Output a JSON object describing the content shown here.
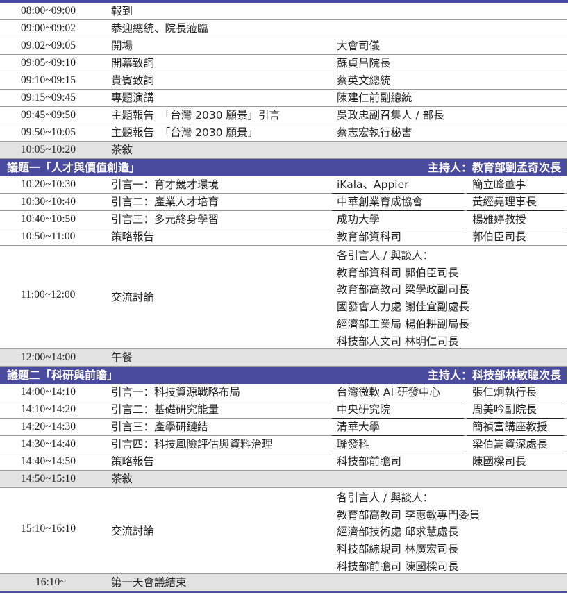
{
  "colors": {
    "accent": "#4a4a9e",
    "gray_row": "#e3e3e3"
  },
  "block1": [
    {
      "time": "08:00~09:00",
      "item": "報到",
      "who": "",
      "role": ""
    },
    {
      "time": "09:00~09:02",
      "item": "恭迎總統、院長蒞臨",
      "who": "",
      "role": ""
    },
    {
      "time": "09:02~09:05",
      "item": "開場",
      "who": "大會司儀",
      "role": ""
    },
    {
      "time": "09:05~09:10",
      "item": "開幕致詞",
      "who": "蘇貞昌院長",
      "role": ""
    },
    {
      "time": "09:10~09:15",
      "item": "貴賓致詞",
      "who": "蔡英文總統",
      "role": ""
    },
    {
      "time": "09:15~09:45",
      "item": "專題演講",
      "who": "陳建仁前副總統",
      "role": ""
    },
    {
      "time": "09:45~09:50",
      "item": "主題報告　「台灣 2030 願景」引言",
      "who": "吳政忠副召集人 / 部長",
      "role": ""
    },
    {
      "time": "09:50~10:05",
      "item": "主題報告　「台灣 2030 願景」",
      "who": "蔡志宏執行秘書",
      "role": ""
    },
    {
      "time": "10:05~10:20",
      "item": "茶敘",
      "who": "",
      "role": ""
    }
  ],
  "section1": {
    "title": "議題一「人才與價值創造」",
    "host": "主持人：教育部劉孟奇次長"
  },
  "block2": [
    {
      "time": "10:20~10:30",
      "item": "引言一：育才競才環境",
      "who": "iKala、Appier",
      "role": "簡立峰董事"
    },
    {
      "time": "10:30~10:40",
      "item": "引言二：產業人才培育",
      "who": "中華創業育成協會",
      "role": "黃經堯理事長"
    },
    {
      "time": "10:40~10:50",
      "item": "引言三：多元終身學習",
      "who": "成功大學",
      "role": "楊雅婷教授"
    },
    {
      "time": "10:50~11:00",
      "item": "策略報告",
      "who": "教育部資科司",
      "role": "郭伯臣司長"
    }
  ],
  "discussion1": {
    "time": "11:00~12:00",
    "item": "交流討論",
    "lines": [
      "各引言人 / 與談人：",
      "教育部資科司  郭伯臣司長",
      "教育部高教司  梁學政副司長",
      "國發會人力處  謝佳宜副處長",
      "經濟部工業局  楊伯耕副局長",
      "科技部人文司  林明仁司長"
    ]
  },
  "lunch": {
    "time": "12:00~14:00",
    "item": "午餐"
  },
  "section2": {
    "title": "議題二「科研與前瞻」",
    "host": "主持人：科技部林敏聰次長"
  },
  "block3": [
    {
      "time": "14:00~14:10",
      "item": "引言一：科技資源戰略布局",
      "who": "台灣微軟 AI 研發中心",
      "role": "張仁炯執行長"
    },
    {
      "time": "14:10~14:20",
      "item": "引言二：基礎研究能量",
      "who": "中央研究院",
      "role": "周美吟副院長"
    },
    {
      "time": "14:20~14:30",
      "item": "引言三：產學研鏈結",
      "who": "清華大學",
      "role": "簡禎富講座教授"
    },
    {
      "time": "14:30~14:40",
      "item": "引言四：科技風險評估與資料治理",
      "who": "聯發科",
      "role": "梁伯嵩資深處長"
    },
    {
      "time": "14:40~14:50",
      "item": "策略報告",
      "who": "科技部前瞻司",
      "role": "陳國樑司長"
    },
    {
      "time": "14:50~15:10",
      "item": "茶敘",
      "who": "",
      "role": ""
    }
  ],
  "discussion2": {
    "time": "15:10~16:10",
    "item": "交流討論",
    "lines": [
      "各引言人 / 與談人：",
      "教育部高教司  李惠敏專門委員",
      "經濟部技術處  邱求慧處長",
      "科技部綜規司  林廣宏司長",
      "科技部前瞻司  陳國樑司長"
    ]
  },
  "closing": {
    "time": "16:10~",
    "item": "第一天會議結束"
  }
}
